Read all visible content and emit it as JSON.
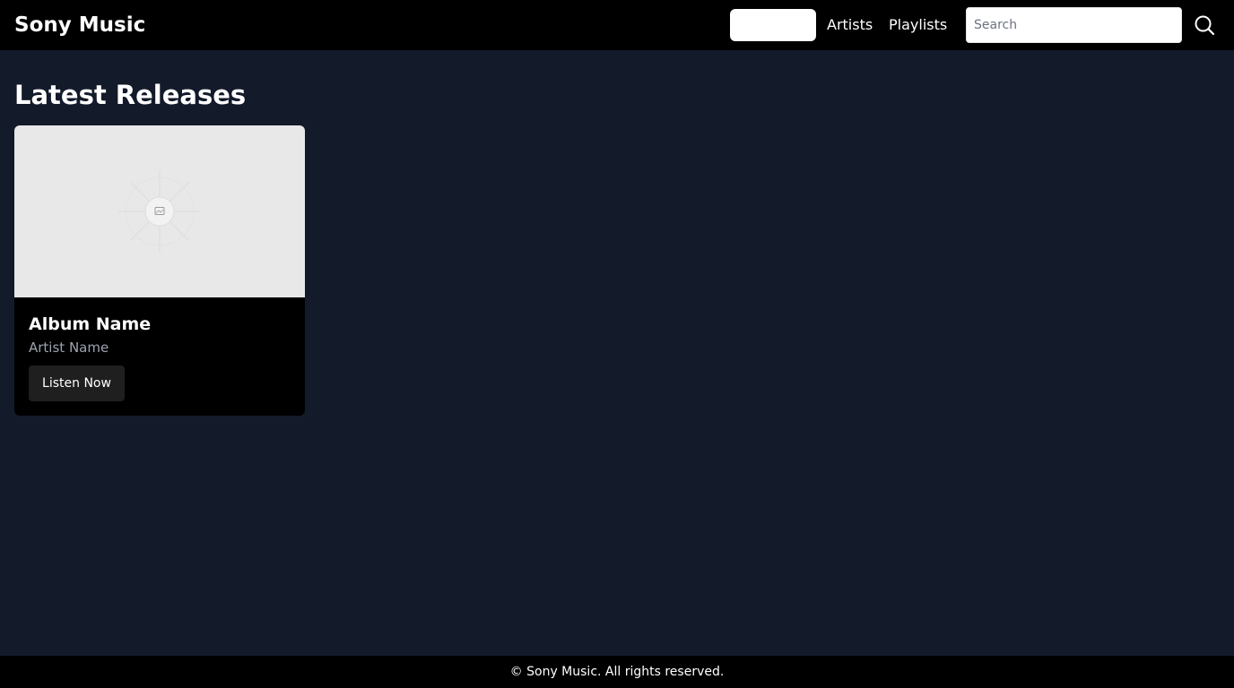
{
  "header": {
    "brand": "Sony Music",
    "nav": {
      "home_label": "",
      "artists_label": "Artists",
      "playlists_label": "Playlists"
    },
    "search": {
      "placeholder": "Search",
      "value": "",
      "icon": "search-icon"
    }
  },
  "main": {
    "section_title": "Latest Releases",
    "releases": [
      {
        "album": "Album Name",
        "artist": "Artist Name",
        "button_label": "Listen Now",
        "image_icon": "image-placeholder-icon"
      }
    ]
  },
  "footer": {
    "text": "© Sony Music. All rights reserved."
  },
  "colors": {
    "page_background": "#131a2a",
    "header_background": "#000000",
    "card_background": "#000000",
    "image_placeholder": "#e8e8e8",
    "muted_text": "#9ca3af",
    "button_background": "#1f1f1f"
  }
}
